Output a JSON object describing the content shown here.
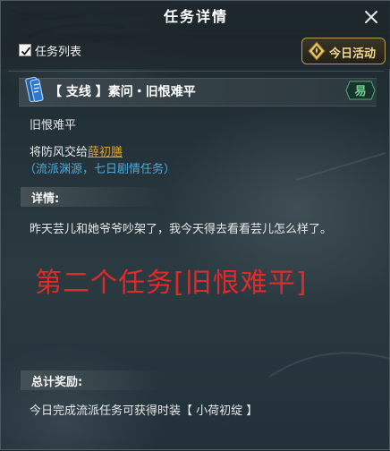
{
  "window": {
    "title": "任务详情"
  },
  "toolbar": {
    "checkbox_label": "任务列表",
    "today_button_label": "今日活动"
  },
  "quest": {
    "title": "【 支线 】素问・旧恨难平",
    "difficulty": "易",
    "name_line": "旧恨难平",
    "objective_prefix": "将防风交给",
    "objective_npc": "薛初膳",
    "hint": "（流派渊源，七日剧情任务）"
  },
  "details": {
    "heading": "详情:",
    "text": "昨天芸儿和她爷爷吵架了，我今天得去看看芸儿怎么样了。"
  },
  "annotation": "第二个任务[旧恨难平]",
  "rewards": {
    "heading": "总计奖励:",
    "text": "今日完成流派任务可获得时装【 小荷初绽 】"
  },
  "colors": {
    "npc_link": "#d9a12e",
    "hint": "#4fa9d9",
    "difficulty": "#6fd18e",
    "annotation": "#e02a2a",
    "today_button_text": "#f2d98c"
  },
  "icons": [
    "close-icon",
    "check-icon",
    "lotus-emblem-icon",
    "quest-scroll-icon",
    "difficulty-badge-icon"
  ]
}
